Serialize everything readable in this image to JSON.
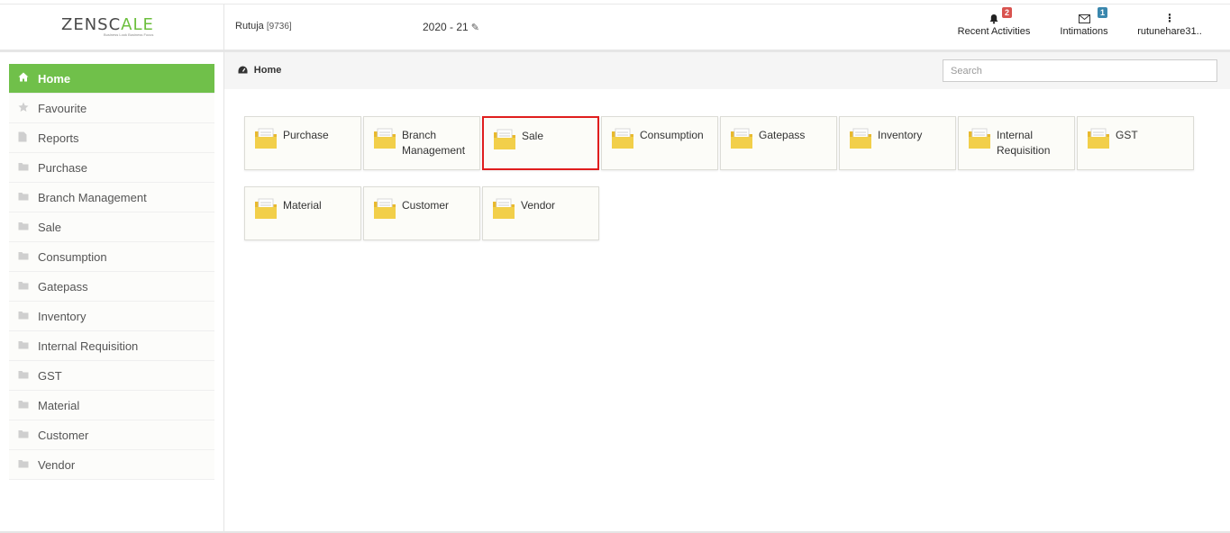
{
  "header": {
    "logo_left": "ZENSC",
    "logo_mid": "A",
    "logo_right": "LE",
    "logo_tagline": "Business Look Business Focus",
    "user_name": "Rutuja",
    "user_id": "[9736]",
    "fiscal_year": "2020 - 21",
    "recent_label": "Recent Activities",
    "recent_count": "2",
    "intimations_label": "Intimations",
    "intimations_count": "1",
    "account_label": "rutunehare31.."
  },
  "sidebar": {
    "items": [
      {
        "label": "Home",
        "icon": "home-icon"
      },
      {
        "label": "Favourite",
        "icon": "star-icon"
      },
      {
        "label": "Reports",
        "icon": "file-icon"
      },
      {
        "label": "Purchase",
        "icon": "folder-icon"
      },
      {
        "label": "Branch Management",
        "icon": "folder-icon"
      },
      {
        "label": "Sale",
        "icon": "folder-icon"
      },
      {
        "label": "Consumption",
        "icon": "folder-icon"
      },
      {
        "label": "Gatepass",
        "icon": "folder-icon"
      },
      {
        "label": "Inventory",
        "icon": "folder-icon"
      },
      {
        "label": "Internal Requisition",
        "icon": "folder-icon"
      },
      {
        "label": "GST",
        "icon": "folder-icon"
      },
      {
        "label": "Material",
        "icon": "folder-icon"
      },
      {
        "label": "Customer",
        "icon": "folder-icon"
      },
      {
        "label": "Vendor",
        "icon": "folder-icon"
      }
    ]
  },
  "breadcrumb": {
    "label": "Home"
  },
  "search": {
    "placeholder": "Search"
  },
  "tiles": [
    {
      "label": "Purchase"
    },
    {
      "label": "Branch Management"
    },
    {
      "label": "Sale"
    },
    {
      "label": "Consumption"
    },
    {
      "label": "Gatepass"
    },
    {
      "label": "Inventory"
    },
    {
      "label": "Internal Requisition"
    },
    {
      "label": "GST"
    },
    {
      "label": "Material"
    },
    {
      "label": "Customer"
    },
    {
      "label": "Vendor"
    }
  ],
  "colors": {
    "accent_green": "#70c04a",
    "selection_red": "#e01e1e",
    "folder_yellow": "#f2cf4a"
  }
}
